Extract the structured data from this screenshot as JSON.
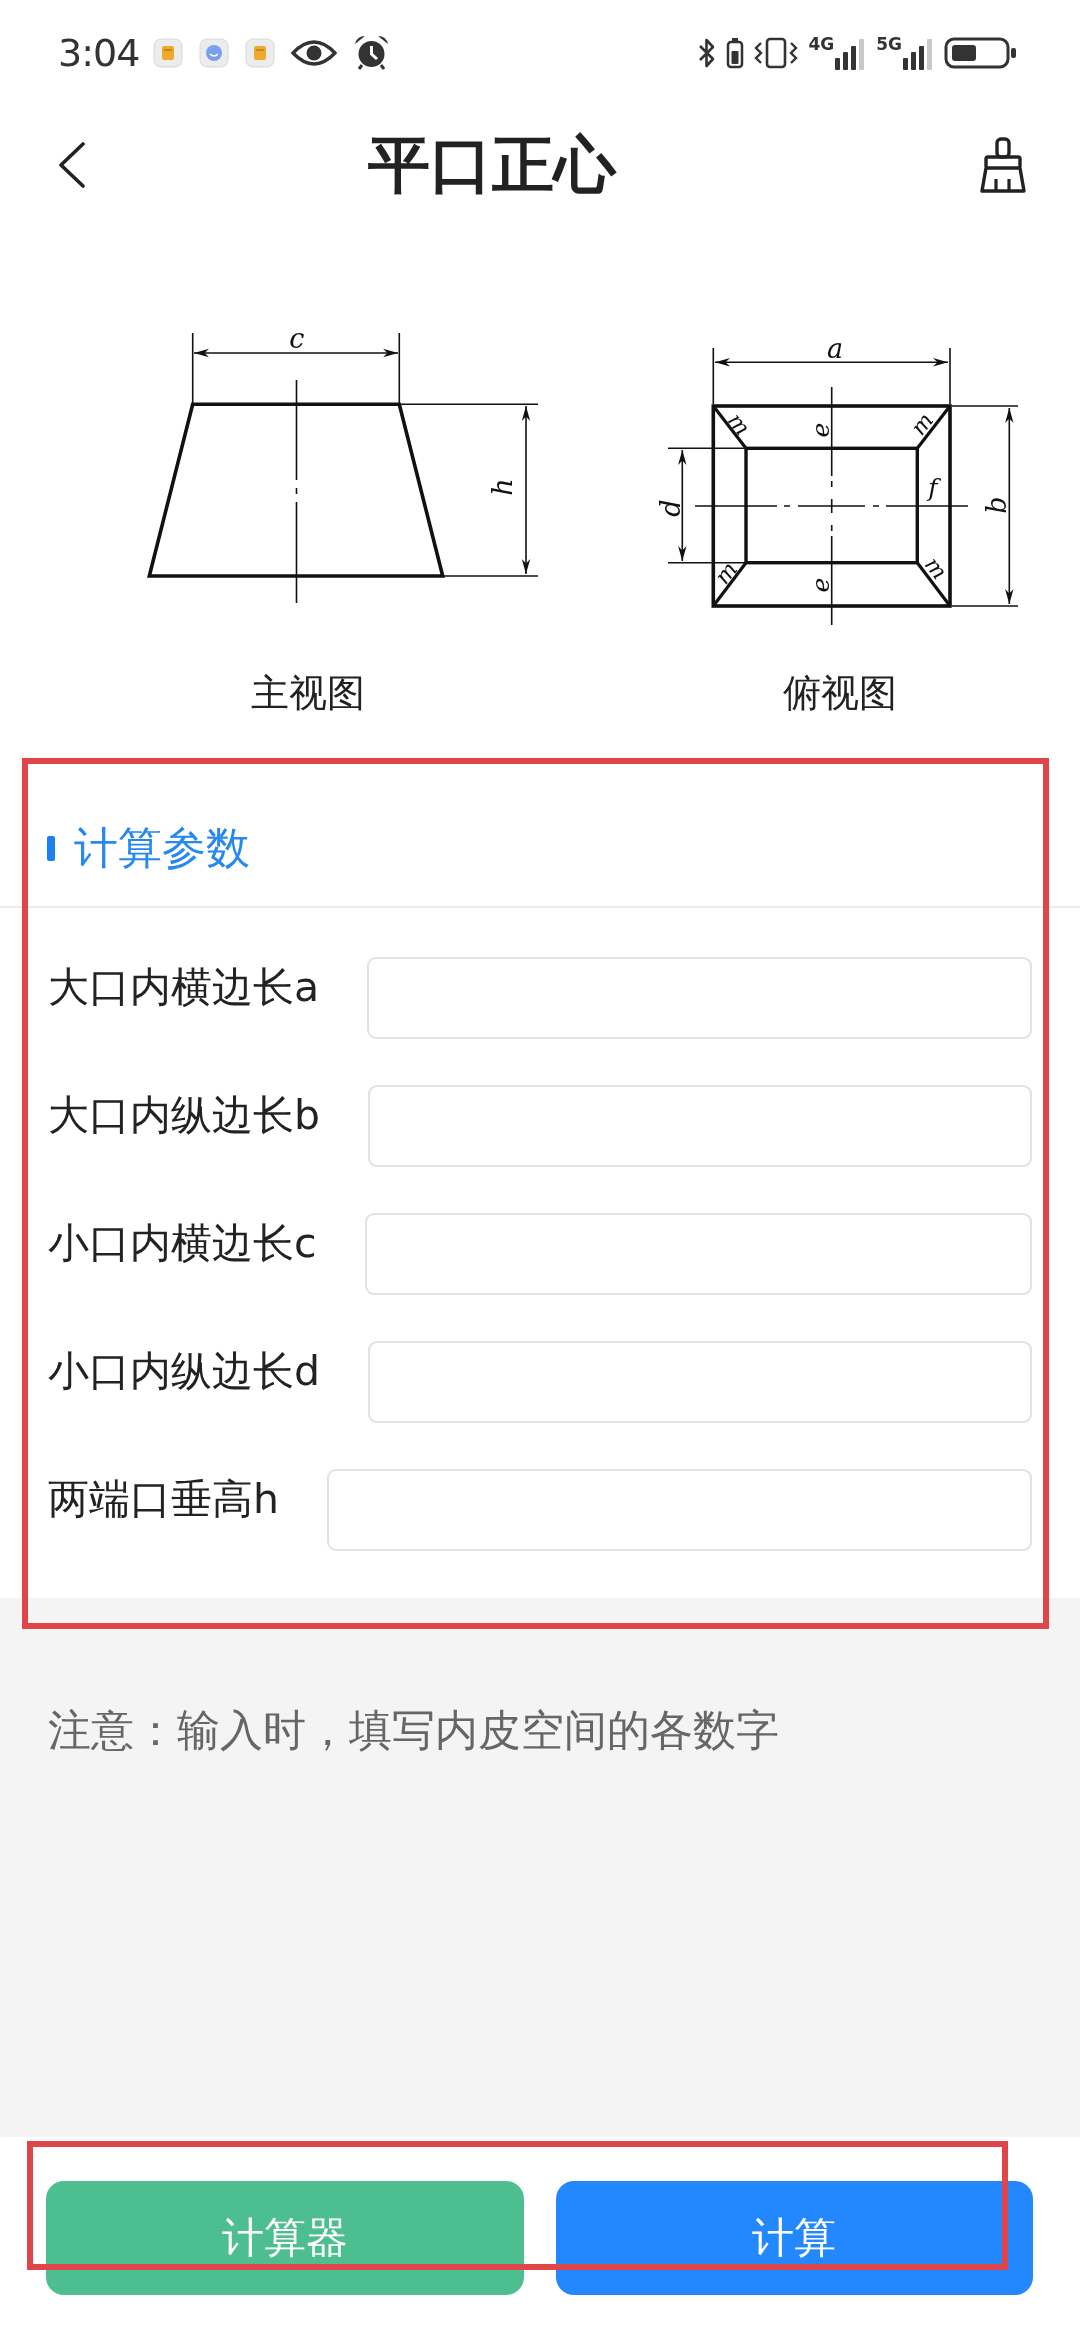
{
  "status_bar": {
    "time": "3:04",
    "networks": [
      {
        "label": "4G"
      },
      {
        "label": "5G"
      }
    ]
  },
  "header": {
    "title": "平口正心"
  },
  "views": [
    {
      "kind": "front",
      "caption": "主视图",
      "labels": [
        "c",
        "h"
      ]
    },
    {
      "kind": "top",
      "caption": "俯视图",
      "labels": [
        "a",
        "m",
        "e",
        "m",
        "d",
        "f",
        "b",
        "m",
        "e",
        "m"
      ]
    }
  ],
  "parameters": {
    "title": "计算参数",
    "highlighted": true,
    "fields": [
      {
        "label": "大口内横边长a"
      },
      {
        "label": "大口内纵边长b"
      },
      {
        "label": "小口内横边长c"
      },
      {
        "label": "小口内纵边长d"
      },
      {
        "label": "两端口垂高h"
      }
    ]
  },
  "note": "注意：输入时，填写内皮空间的各数字",
  "actions": {
    "highlighted": true,
    "buttons": [
      {
        "label": "计算器",
        "kind": "calculator"
      },
      {
        "label": "计算",
        "kind": "calculate"
      }
    ]
  }
}
